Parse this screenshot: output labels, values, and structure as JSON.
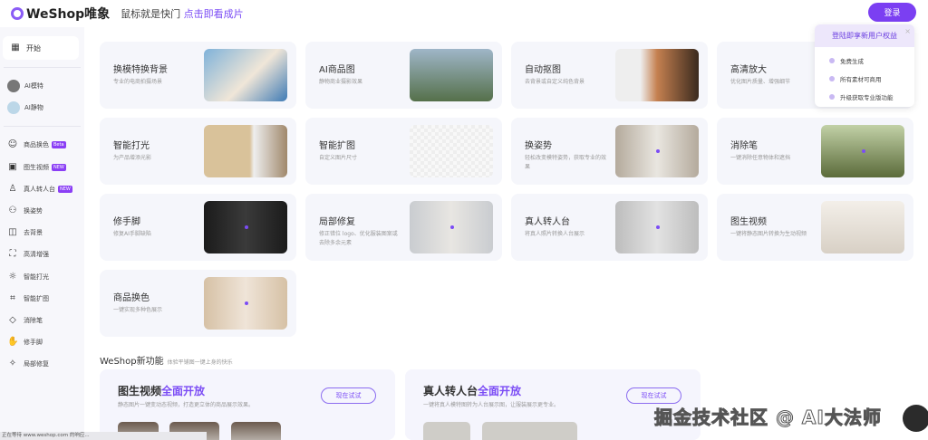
{
  "header": {
    "logo": "WeShop唯象",
    "slogan": "鼠标就是快门",
    "slogan_link": "点击即看成片",
    "login": "登录"
  },
  "sidebar": {
    "start": "开始",
    "top_items": [
      {
        "label": "AI模特"
      },
      {
        "label": "AI静物"
      }
    ],
    "items": [
      {
        "label": "商品换色",
        "badge": "Beta",
        "icon": "palette-icon"
      },
      {
        "label": "图生视频",
        "badge": "NEW",
        "icon": "video-icon"
      },
      {
        "label": "真人转人台",
        "badge": "NEW",
        "icon": "mannequin-icon"
      },
      {
        "label": "换姿势",
        "icon": "pose-icon"
      },
      {
        "label": "去背景",
        "icon": "split-icon"
      },
      {
        "label": "高清增强",
        "icon": "enhance-icon"
      },
      {
        "label": "智能打光",
        "icon": "light-icon"
      },
      {
        "label": "智能扩图",
        "icon": "crop-icon"
      },
      {
        "label": "消除笔",
        "icon": "eraser-icon"
      },
      {
        "label": "修手脚",
        "icon": "hand-icon"
      },
      {
        "label": "局部修复",
        "icon": "magic-wand-icon"
      }
    ]
  },
  "cards": [
    {
      "title": "换模特换背景",
      "desc": "专业的电商拍摄场景"
    },
    {
      "title": "AI商品图",
      "desc": "静物商业摄影效果"
    },
    {
      "title": "自动抠图",
      "desc": "去背景或自定义纯色背景"
    },
    {
      "title": "高清放大",
      "desc": "优化图片质量、增强细节"
    },
    {
      "title": "智能打光",
      "desc": "为产品增添光影"
    },
    {
      "title": "智能扩图",
      "desc": "自定义图片尺寸"
    },
    {
      "title": "换姿势",
      "desc": "轻松改变模特姿势，获取专业的效果"
    },
    {
      "title": "消除笔",
      "desc": "一键消除任意物体和遮挡"
    },
    {
      "title": "修手脚",
      "desc": "修复AI手脚缺陷"
    },
    {
      "title": "局部修复",
      "desc": "修正错位 logo、优化服装图案或去除多余元素"
    },
    {
      "title": "真人转人台",
      "desc": "将真人照片转换人台展示"
    },
    {
      "title": "图生视频",
      "desc": "一键将静态图片转换为生动视频"
    },
    {
      "title": "商品换色",
      "desc": "一键实现多种色展示"
    }
  ],
  "popup": {
    "title": "登陆即享新用户权益",
    "items": [
      "免费生成",
      "所有素材可商用",
      "升级获取专业版功能"
    ]
  },
  "section": {
    "title": "WeShop新功能",
    "subtitle": "体验平铺图一键上身的快乐"
  },
  "promos": [
    {
      "title_a": "图生视频",
      "title_b": "全面开放",
      "desc": "静态图片一键变动态视频，打造更立体的商品展示效果。",
      "button": "现在试试"
    },
    {
      "title_a": "真人转人台",
      "title_b": "全面开放",
      "desc": "一键将真人模特图转为人台展示图，让服装展示更专业。",
      "button": "现在试试"
    }
  ],
  "status": "正在等待 www.weshop.com 的响应...",
  "watermark": "掘金技术社区 @ AI大法师"
}
